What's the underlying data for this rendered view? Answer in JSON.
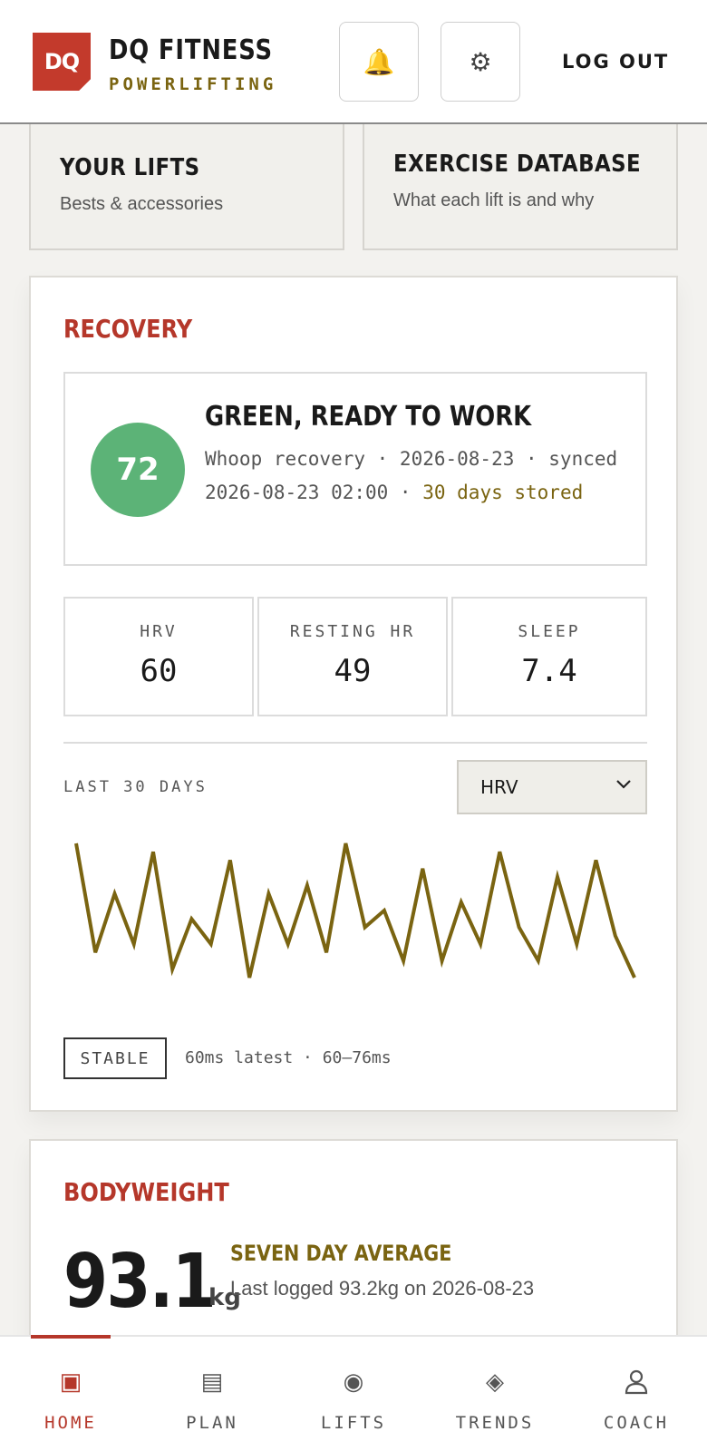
{
  "header": {
    "logo": "DQ",
    "brand_title": "DQ FITNESS",
    "brand_subtitle": "POWERLIFTING",
    "logout_label": "LOG OUT"
  },
  "tiles": [
    {
      "title": "YOUR LIFTS",
      "subtitle": "Bests & accessories"
    },
    {
      "title": "EXERCISE DATABASE",
      "subtitle": "What each lift is and why"
    }
  ],
  "recovery": {
    "title": "RECOVERY",
    "score": "72",
    "status_title": "GREEN, READY TO WORK",
    "status_text": "Whoop recovery · 2026-08-23 · synced 2026-08-23 02:00 ·",
    "status_highlight": "30 days stored",
    "metrics": [
      {
        "label": "HRV",
        "value": "60"
      },
      {
        "label": "RESTING HR",
        "value": "49"
      },
      {
        "label": "SLEEP",
        "value": "7.4"
      }
    ],
    "range_label": "LAST 30 DAYS",
    "metric_select": "HRV",
    "trend_badge": "STABLE",
    "trend_note": "60ms latest · 60–76ms",
    "line_color": "#7a6411",
    "score_color": "#5cb377"
  },
  "chart_data": {
    "type": "line",
    "title": "",
    "xlabel": "",
    "ylabel": "",
    "ylim": [
      60,
      76
    ],
    "x": [
      1,
      2,
      3,
      4,
      5,
      6,
      7,
      8,
      9,
      10,
      11,
      12,
      13,
      14,
      15,
      16,
      17,
      18,
      19,
      20,
      21,
      22,
      23,
      24,
      25,
      26,
      27,
      28,
      29,
      30
    ],
    "series": [
      {
        "name": "",
        "values": [
          76,
          63,
          70,
          64,
          75,
          61,
          67,
          64,
          74,
          60,
          70,
          64,
          71,
          63,
          76,
          66,
          68,
          62,
          73,
          62,
          69,
          64,
          75,
          66,
          62,
          72,
          64,
          74,
          65,
          60
        ]
      }
    ]
  },
  "bodyweight": {
    "title": "BODYWEIGHT",
    "value": "93.1",
    "unit": "kg",
    "avg_title": "SEVEN DAY AVERAGE",
    "last_logged": "Last logged 93.2kg on 2026-08-23"
  },
  "nav": {
    "items": [
      {
        "label": "HOME",
        "icon": "home-icon"
      },
      {
        "label": "PLAN",
        "icon": "plan-icon"
      },
      {
        "label": "LIFTS",
        "icon": "lifts-icon"
      },
      {
        "label": "TRENDS",
        "icon": "trends-icon"
      },
      {
        "label": "COACH",
        "icon": "coach-icon"
      }
    ]
  }
}
